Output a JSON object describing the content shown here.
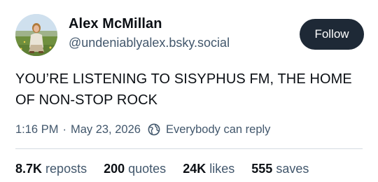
{
  "author": {
    "display_name": "Alex McMillan",
    "handle": "@undeniablyalex.bsky.social",
    "avatar_icon": "profile-photo"
  },
  "follow_button": {
    "label": "Follow",
    "background": "#1e2936",
    "text_color": "#ffffff"
  },
  "post": {
    "text": "YOU’RE LISTENING TO SISYPHUS FM, THE HOME OF NON-STOP ROCK",
    "time": "1:16 PM",
    "separator": "·",
    "date": "May 23, 2026",
    "reply_setting": {
      "icon": "globe-icon",
      "label": "Everybody can reply"
    }
  },
  "stats": {
    "reposts": {
      "count": "8.7K",
      "label": "reposts"
    },
    "quotes": {
      "count": "200",
      "label": "quotes"
    },
    "likes": {
      "count": "24K",
      "label": "likes"
    },
    "saves": {
      "count": "555",
      "label": "saves"
    }
  },
  "colors": {
    "primary_text": "#0b0f14",
    "secondary_text": "#42576c",
    "divider": "#d4dbe2"
  }
}
